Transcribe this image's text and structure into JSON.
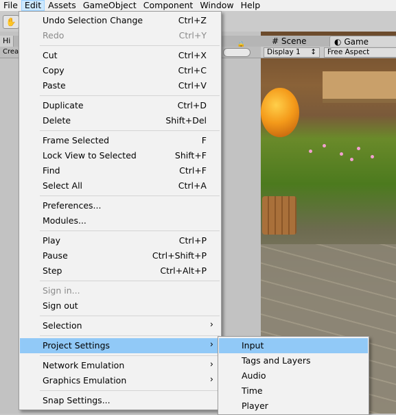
{
  "menubar": {
    "items": [
      "File",
      "Edit",
      "Assets",
      "GameObject",
      "Component",
      "Window",
      "Help"
    ]
  },
  "hierarchy": {
    "tab_label": "Hi",
    "create_label": "Crea"
  },
  "gameview": {
    "scene_tab": "Scene",
    "game_tab": "Game",
    "display": "Display 1",
    "aspect": "Free Aspect"
  },
  "edit_menu": {
    "undo": {
      "label": "Undo Selection Change",
      "shortcut": "Ctrl+Z"
    },
    "redo": {
      "label": "Redo",
      "shortcut": "Ctrl+Y"
    },
    "cut": {
      "label": "Cut",
      "shortcut": "Ctrl+X"
    },
    "copy": {
      "label": "Copy",
      "shortcut": "Ctrl+C"
    },
    "paste": {
      "label": "Paste",
      "shortcut": "Ctrl+V"
    },
    "duplicate": {
      "label": "Duplicate",
      "shortcut": "Ctrl+D"
    },
    "delete": {
      "label": "Delete",
      "shortcut": "Shift+Del"
    },
    "frame_selected": {
      "label": "Frame Selected",
      "shortcut": "F"
    },
    "lock_view": {
      "label": "Lock View to Selected",
      "shortcut": "Shift+F"
    },
    "find": {
      "label": "Find",
      "shortcut": "Ctrl+F"
    },
    "select_all": {
      "label": "Select All",
      "shortcut": "Ctrl+A"
    },
    "preferences": {
      "label": "Preferences..."
    },
    "modules": {
      "label": "Modules..."
    },
    "play": {
      "label": "Play",
      "shortcut": "Ctrl+P"
    },
    "pause": {
      "label": "Pause",
      "shortcut": "Ctrl+Shift+P"
    },
    "step": {
      "label": "Step",
      "shortcut": "Ctrl+Alt+P"
    },
    "sign_in": {
      "label": "Sign in..."
    },
    "sign_out": {
      "label": "Sign out"
    },
    "selection": {
      "label": "Selection"
    },
    "project_settings": {
      "label": "Project Settings"
    },
    "network_emulation": {
      "label": "Network Emulation"
    },
    "graphics_emulation": {
      "label": "Graphics Emulation"
    },
    "snap_settings": {
      "label": "Snap Settings..."
    }
  },
  "project_settings_submenu": {
    "items": [
      "Input",
      "Tags and Layers",
      "Audio",
      "Time",
      "Player"
    ]
  },
  "colors": {
    "highlight": "#91c9f7",
    "menubar_active": "#cce8ff",
    "menu_bg": "#f2f2f2"
  }
}
